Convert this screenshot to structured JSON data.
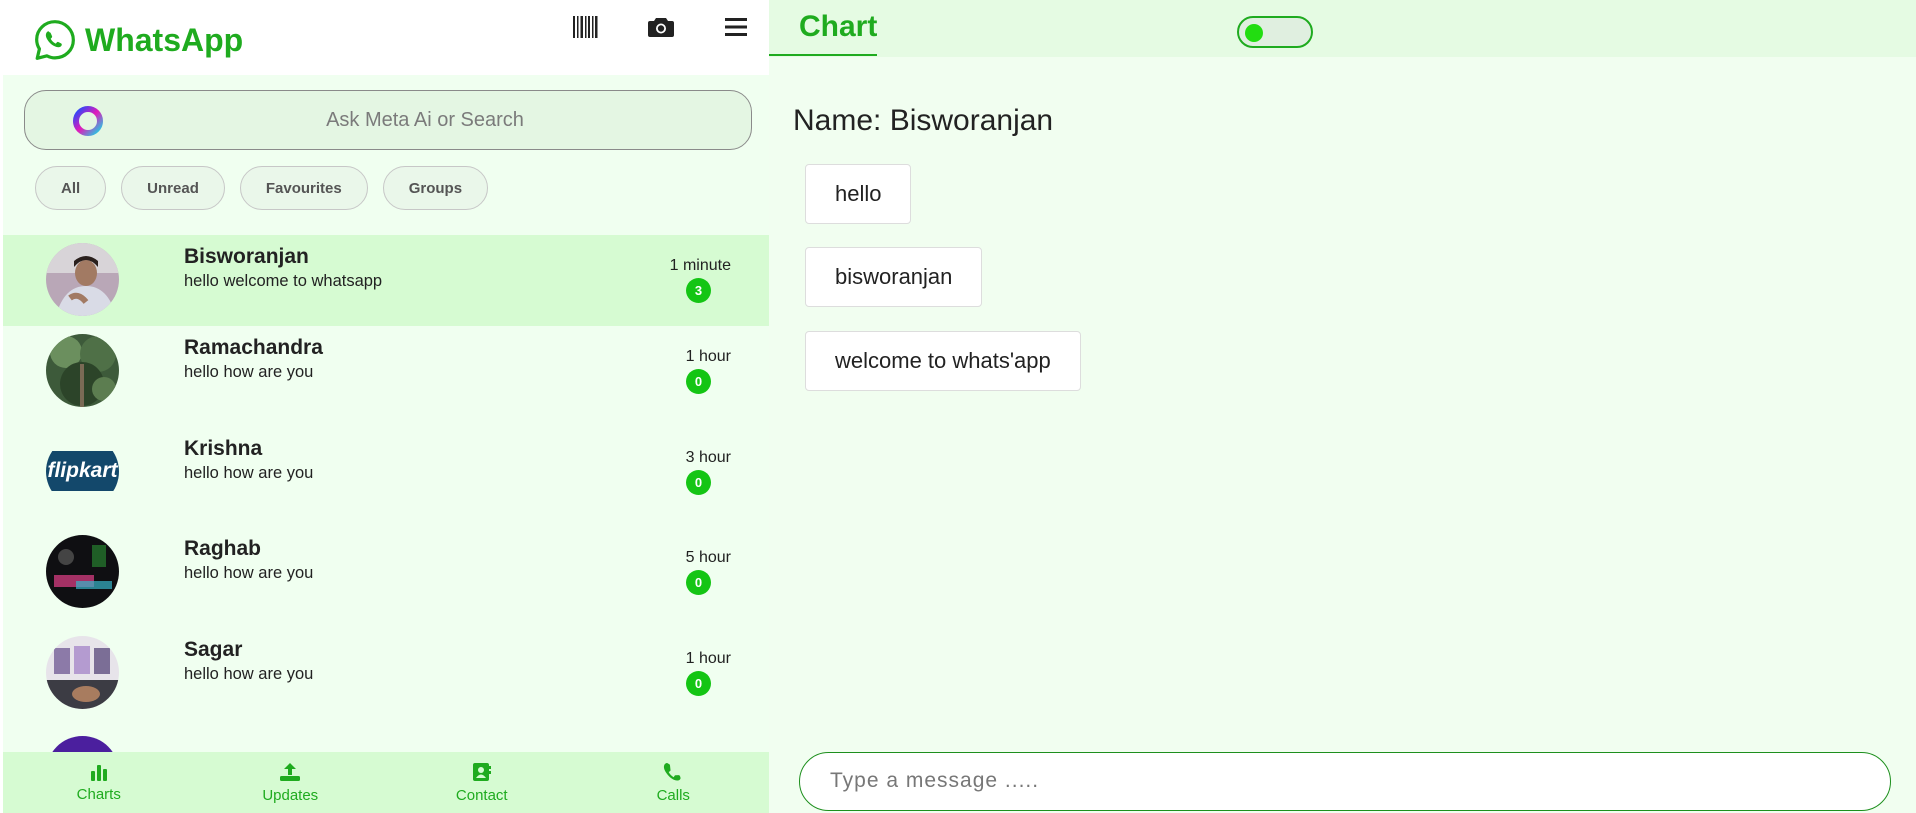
{
  "app": {
    "title": "WhatsApp"
  },
  "header": {
    "icons": [
      "barcode-icon",
      "camera-icon",
      "menu-icon"
    ]
  },
  "search": {
    "placeholder": "Ask Meta Ai or Search"
  },
  "filters": [
    {
      "label": "All"
    },
    {
      "label": "Unread"
    },
    {
      "label": "Favourites"
    },
    {
      "label": "Groups"
    }
  ],
  "chats": [
    {
      "name": "Bisworanjan",
      "message": "hello welcome to whatsapp",
      "time": "1 minute",
      "unread": "3",
      "active": true
    },
    {
      "name": "Ramachandra",
      "message": "hello how are you",
      "time": "1 hour",
      "unread": "0"
    },
    {
      "name": "Krishna",
      "message": "hello how are you",
      "time": "3 hour",
      "unread": "0",
      "avatar_text": "flipkart"
    },
    {
      "name": "Raghab",
      "message": "hello how are you",
      "time": "5 hour",
      "unread": "0"
    },
    {
      "name": "Sagar",
      "message": "hello how are you",
      "time": "1 hour",
      "unread": "0"
    }
  ],
  "nav": [
    {
      "label": "Charts",
      "icon": "bar-chart-icon"
    },
    {
      "label": "Updates",
      "icon": "upload-icon"
    },
    {
      "label": "Contact",
      "icon": "contact-card-icon"
    },
    {
      "label": "Calls",
      "icon": "phone-icon"
    }
  ],
  "conversation": {
    "title": "Chart",
    "contact_label": "Name: Bisworanjan",
    "messages": [
      "hello",
      "bisworanjan",
      "welcome to whats'app"
    ],
    "composer_placeholder": "Type a message ....."
  },
  "colors": {
    "brand": "#1fab1f",
    "badge": "#14c514",
    "active_row": "#d6fbd2",
    "panel_bg": "#f0fff0"
  }
}
